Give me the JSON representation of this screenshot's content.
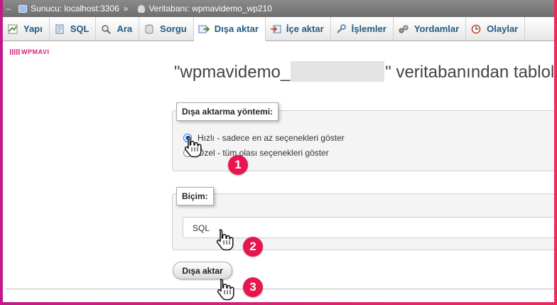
{
  "topbar": {
    "dash": "–",
    "server": "Sunucu: localhost:3306",
    "separator": "»",
    "database": "Veritabanı: wpmavidemo_wp210"
  },
  "tabs": [
    {
      "label": "Yapı",
      "icon": "structure-icon"
    },
    {
      "label": "SQL",
      "icon": "sql-icon"
    },
    {
      "label": "Ara",
      "icon": "search-icon"
    },
    {
      "label": "Sorgu",
      "icon": "query-icon"
    },
    {
      "label": "Dışa aktar",
      "icon": "export-icon",
      "active": true
    },
    {
      "label": "İçe aktar",
      "icon": "import-icon"
    },
    {
      "label": "İşlemler",
      "icon": "wrench-icon"
    },
    {
      "label": "Yordamlar",
      "icon": "routines-icon"
    },
    {
      "label": "Olaylar",
      "icon": "clock-icon"
    }
  ],
  "logo": "WPMAVI",
  "heading": {
    "prefix": "\"wpmavidemo_",
    "suffix": "\" veritabanından tablolar d"
  },
  "export_method": {
    "legend": "Dışa aktarma yöntemi:",
    "options": [
      {
        "label": "Hızlı - sadece en az seçenekleri göster",
        "checked": true
      },
      {
        "label": "Özel - tüm olası seçenekleri göster",
        "checked": false
      }
    ]
  },
  "format": {
    "legend": "Biçim:",
    "selected": "SQL"
  },
  "submit_label": "Dışa aktar",
  "steps": [
    "1",
    "2",
    "3"
  ],
  "colors": {
    "accent": "#e8164f",
    "tab_text": "#235a81",
    "radio_checked": "#1a73e8"
  }
}
